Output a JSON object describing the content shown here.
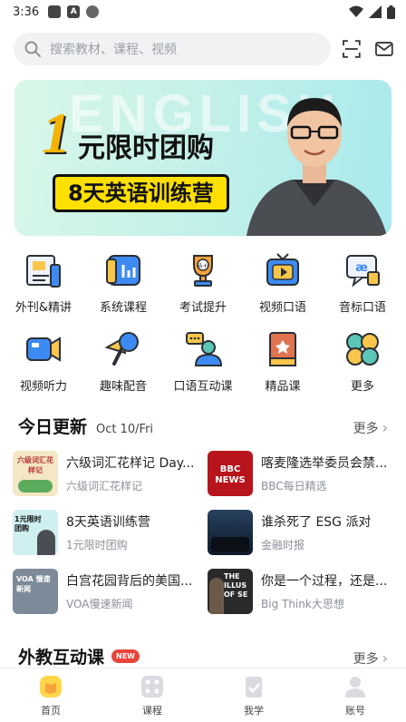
{
  "status_bar": {
    "time": "3:36"
  },
  "search": {
    "placeholder": "搜索教材、课程、视频"
  },
  "banner": {
    "watermark": "ENGLISH",
    "big_number": "1",
    "headline": "元限时团购",
    "pill_text": "8天英语训练营"
  },
  "grid": {
    "row1": [
      {
        "label": "外刊&精讲",
        "icon": "newspaper-icon"
      },
      {
        "label": "系统课程",
        "icon": "bar-chart-icon"
      },
      {
        "label": "考试提升",
        "icon": "trophy-icon"
      },
      {
        "label": "视频口语",
        "icon": "tv-play-icon"
      },
      {
        "label": "音标口语",
        "icon": "speech-bubble-icon"
      }
    ],
    "row2": [
      {
        "label": "视频听力",
        "icon": "camera-icon"
      },
      {
        "label": "趣味配音",
        "icon": "microphone-icon"
      },
      {
        "label": "口语互动课",
        "icon": "tutor-icon"
      },
      {
        "label": "精品课",
        "icon": "book-icon"
      },
      {
        "label": "更多",
        "icon": "clover-icon"
      }
    ]
  },
  "today": {
    "title": "今日更新",
    "date": "Oct 10/Fri",
    "more": "更多",
    "items": [
      {
        "title": "六级词汇花样记 Day...",
        "sub": "六级词汇花样记",
        "thumb_text": "六级词汇花样记"
      },
      {
        "title": "喀麦隆选举委员会禁...",
        "sub": "BBC每日精选",
        "thumb_text": "BBC NEWS"
      },
      {
        "title": "8天英语训练营",
        "sub": "1元限时团购",
        "thumb_text": "1元限时团购"
      },
      {
        "title": "谁杀死了 ESG 派对",
        "sub": "金融时报",
        "thumb_text": ""
      },
      {
        "title": "白宫花园背后的美国...",
        "sub": "VOA慢速新闻",
        "thumb_text": "VOA 慢速新闻"
      },
      {
        "title": "你是一个过程，还是...",
        "sub": "Big Think大思想",
        "thumb_text": "THE ILLUS OF SE"
      }
    ]
  },
  "foreign": {
    "title": "外教互动课",
    "badge": "NEW",
    "more": "更多"
  },
  "nav": [
    {
      "label": "首页",
      "icon": "home-icon",
      "active": true
    },
    {
      "label": "课程",
      "icon": "grid-icon",
      "active": false
    },
    {
      "label": "我学",
      "icon": "clipboard-check-icon",
      "active": false
    },
    {
      "label": "账号",
      "icon": "person-icon",
      "active": false
    }
  ],
  "colors": {
    "accent": "#f5b400",
    "banner_yellow": "#ffe000",
    "icon_blue": "#3d8bf2",
    "icon_orange": "#f7a23b"
  }
}
